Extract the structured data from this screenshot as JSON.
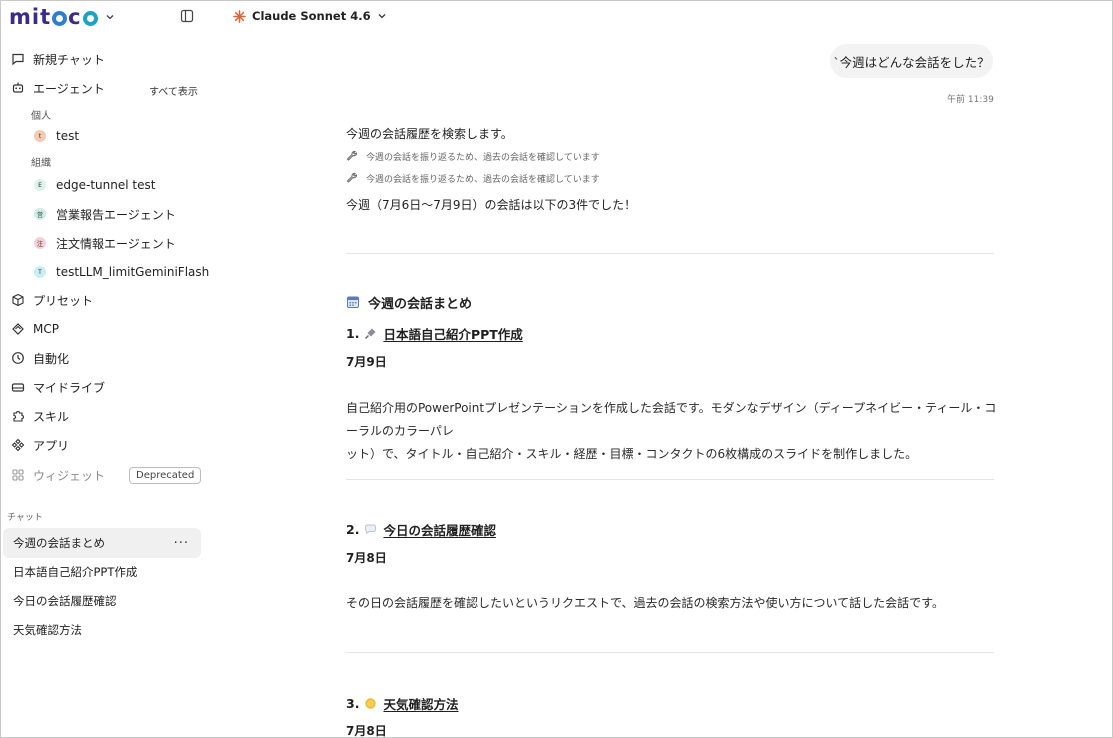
{
  "brand": {
    "logo_text": "mitoco"
  },
  "sidebar": {
    "new_chat": "新規チャット",
    "agents_label": "エージェント",
    "show_all": "すべて表示",
    "personal_label": "個人",
    "org_label": "組織",
    "agents_personal": [
      {
        "initial": "t",
        "name": "test",
        "color": "#f6c9b3"
      }
    ],
    "agents_org": [
      {
        "initial": "E",
        "name": "edge-tunnel test",
        "color": "#d9f2ea"
      },
      {
        "initial": "営",
        "name": "営業報告エージェント",
        "color": "#cdeee6"
      },
      {
        "initial": "注",
        "name": "注文情報エージェント",
        "color": "#f8d0d6"
      },
      {
        "initial": "T",
        "name": "testLLM_limitGeminiFlash",
        "color": "#c9eef2"
      }
    ],
    "presets": "プリセット",
    "mcp": "MCP",
    "automation": "自動化",
    "my_drive": "マイドライブ",
    "skills": "スキル",
    "apps": "アプリ",
    "widgets": "ウィジェット",
    "widgets_badge": "Deprecated",
    "chat_section": "チャット",
    "chats": [
      "今週の会話まとめ",
      "日本語自己紹介PPT作成",
      "今日の会話履歴確認",
      "天気確認方法"
    ],
    "more": "···"
  },
  "header": {
    "model_name": "Claude Sonnet 4.6"
  },
  "conversation": {
    "user_message": "`今週はどんな会話をした？",
    "user_time": "午前 11:39",
    "intro": "今週の会話履歴を検索します。",
    "tool_calls": [
      "今週の会話を振り返るため、過去の会話を確認しています",
      "今週の会話を振り返るため、過去の会話を確認しています"
    ],
    "summary_line": "今週（7月6日〜7月9日）の会話は以下の3件でした！",
    "section_title": "今週の会話まとめ",
    "items": [
      {
        "num": "1.",
        "title": "日本語自己紹介PPT作成",
        "date": "7月9日",
        "body_line1": "自己紹介用のPowerPointプレゼンテーションを作成した会話です。モダンなデザイン（ディープネイビー・ティール・コーラルのカラーパレ",
        "body_line2": "ット）で、タイトル・自己紹介・スキル・経歴・目標・コンタクトの6枚構成のスライドを制作しました。"
      },
      {
        "num": "2.",
        "title": "今日の会話履歴確認",
        "date": "7月8日",
        "body_line1": "その日の会話履歴を確認したいというリクエストで、過去の会話の検索方法や使い方について話した会話です。"
      },
      {
        "num": "3.",
        "title": "天気確認方法",
        "date": "7月8日"
      }
    ]
  }
}
